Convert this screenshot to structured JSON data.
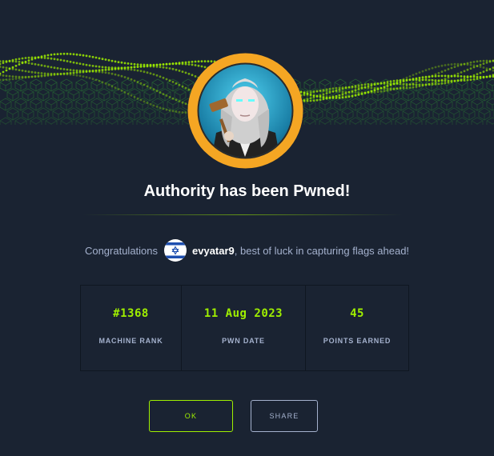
{
  "machine": {
    "name": "Authority"
  },
  "header": {
    "title": "Authority has been Pwned!"
  },
  "congrats": {
    "prefix": "Congratulations",
    "username": "evyatar9",
    "suffix": ", best of luck in capturing flags ahead!",
    "flag_icon": "israel-flag-icon"
  },
  "stats": [
    {
      "value": "#1368",
      "label": "MACHINE RANK"
    },
    {
      "value": "11 Aug 2023",
      "label": "PWN DATE"
    },
    {
      "value": "45",
      "label": "POINTS EARNED"
    }
  ],
  "buttons": {
    "ok": "OK",
    "share": "SHARE"
  },
  "colors": {
    "background": "#1a2332",
    "accent": "#9fef00",
    "muted": "#a4b1cd",
    "avatar_ring": "#f5a623"
  }
}
